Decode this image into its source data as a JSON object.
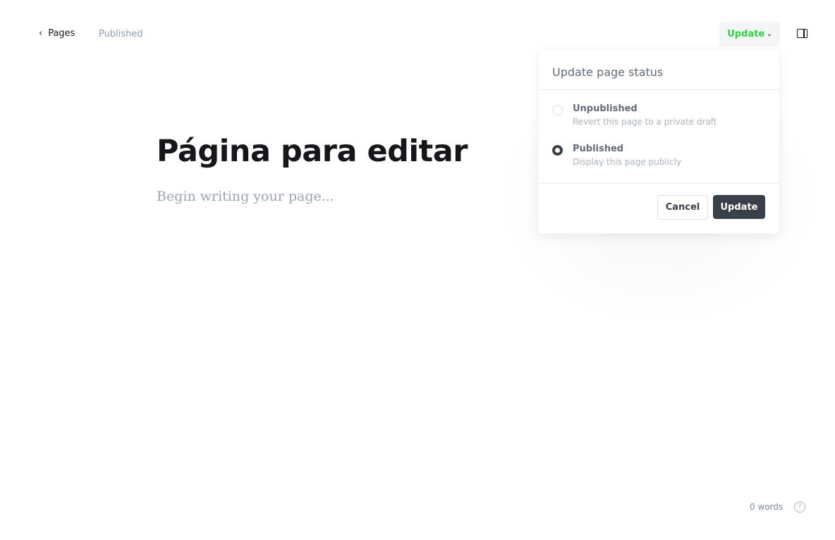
{
  "header": {
    "back_label": "Pages",
    "status": "Published",
    "update_label": "Update"
  },
  "editor": {
    "title": "Página para editar",
    "placeholder": "Begin writing your page..."
  },
  "popup": {
    "title": "Update page status",
    "options": [
      {
        "label": "Unpublished",
        "desc": "Revert this page to a private draft",
        "selected": false
      },
      {
        "label": "Published",
        "desc": "Display this page publicly",
        "selected": true
      }
    ],
    "cancel": "Cancel",
    "confirm": "Update"
  },
  "footer": {
    "words": "0 words",
    "help": "?"
  },
  "colors": {
    "accent": "#30cf43",
    "dark": "#394047"
  }
}
